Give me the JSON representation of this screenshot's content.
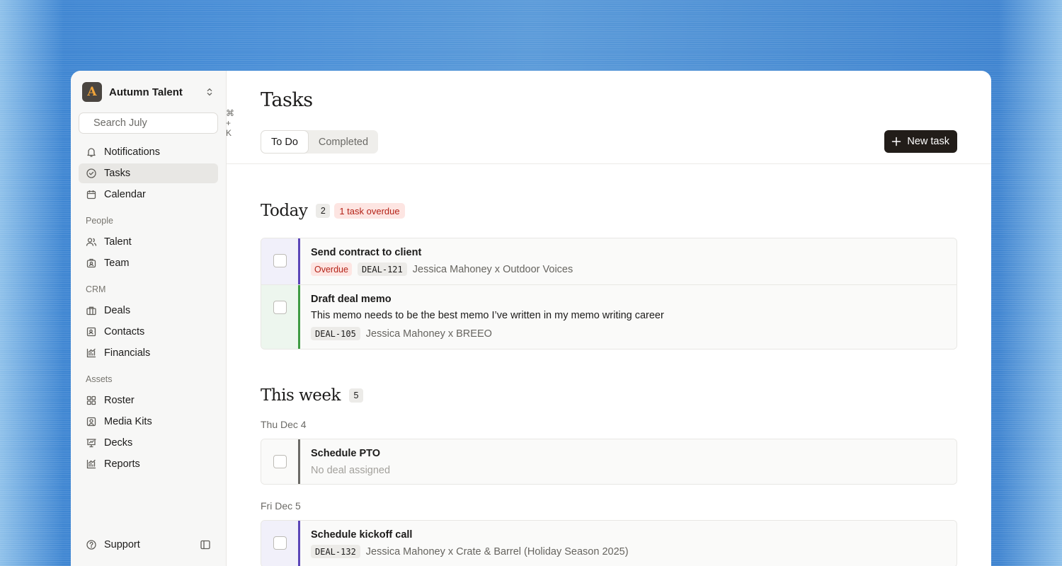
{
  "workspace": {
    "logo_letter": "A",
    "name": "Autumn Talent"
  },
  "search": {
    "placeholder": "Search July",
    "shortcut": "⌘ + K"
  },
  "nav": {
    "top": [
      {
        "label": "Notifications",
        "icon": "bell-icon"
      },
      {
        "label": "Tasks",
        "icon": "check-circle-icon",
        "active": true
      },
      {
        "label": "Calendar",
        "icon": "calendar-icon"
      }
    ],
    "people_label": "People",
    "people": [
      {
        "label": "Talent",
        "icon": "users-icon"
      },
      {
        "label": "Team",
        "icon": "id-badge-icon"
      }
    ],
    "crm_label": "CRM",
    "crm": [
      {
        "label": "Deals",
        "icon": "briefcase-icon"
      },
      {
        "label": "Contacts",
        "icon": "contact-card-icon"
      },
      {
        "label": "Financials",
        "icon": "chart-icon"
      }
    ],
    "assets_label": "Assets",
    "assets": [
      {
        "label": "Roster",
        "icon": "grid-icon"
      },
      {
        "label": "Media Kits",
        "icon": "portrait-icon"
      },
      {
        "label": "Decks",
        "icon": "presentation-icon"
      },
      {
        "label": "Reports",
        "icon": "chart-icon"
      }
    ],
    "support_label": "Support"
  },
  "header": {
    "title": "Tasks",
    "tabs": [
      {
        "label": "To Do",
        "active": true
      },
      {
        "label": "Completed"
      }
    ],
    "new_task_label": "New task"
  },
  "today": {
    "title": "Today",
    "count": "2",
    "overdue_text": "1 task overdue",
    "tasks": [
      {
        "title": "Send contract to client",
        "overdue_tag": "Overdue",
        "deal_id": "DEAL-121",
        "deal_name": "Jessica Mahoney x Outdoor Voices",
        "accent": "#5b45b8",
        "tint": "#f1f0fa"
      },
      {
        "title": "Draft deal memo",
        "description": "This memo needs to be the best memo I’ve written in my memo writing career",
        "deal_id": "DEAL-105",
        "deal_name": "Jessica Mahoney x BREEO",
        "accent": "#3f9b43",
        "tint": "#edf6ee"
      }
    ]
  },
  "this_week": {
    "title": "This week",
    "count": "5",
    "days": [
      {
        "date": "Thu Dec 4",
        "tasks": [
          {
            "title": "Schedule PTO",
            "no_deal": "No deal assigned",
            "accent": "#6b6a66",
            "tint": "#fafaf9"
          }
        ]
      },
      {
        "date": "Fri Dec 5",
        "tasks": [
          {
            "title": "Schedule kickoff call",
            "deal_id": "DEAL-132",
            "deal_name": "Jessica Mahoney x Crate & Barrel (Holiday Season 2025)",
            "accent": "#5b45b8",
            "tint": "#f1f0fa"
          }
        ]
      }
    ]
  }
}
